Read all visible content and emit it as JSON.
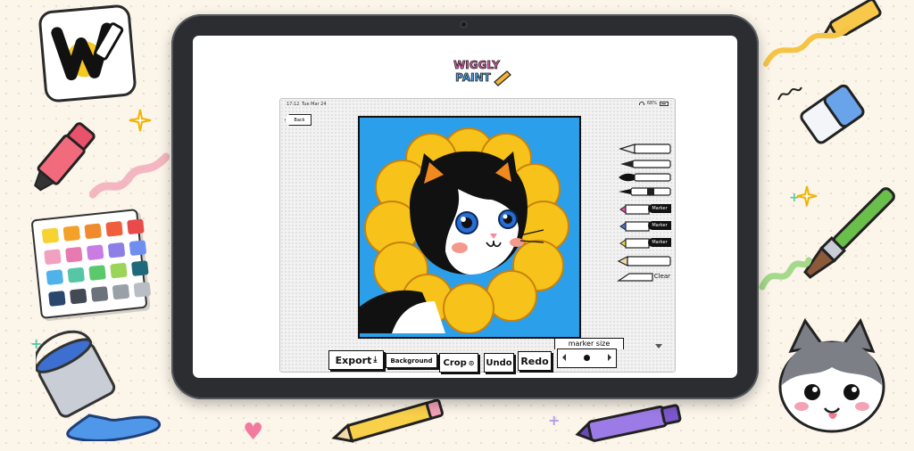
{
  "app": {
    "logo": {
      "line1": "WIGGLY",
      "line2": "PAINT"
    },
    "status": {
      "time": "17:12",
      "date": "Tue Mar 24",
      "battery": "68%"
    },
    "back_label": "Back",
    "toolbar": {
      "export": "Export",
      "background": "Background",
      "crop": "Crop",
      "undo": "Undo",
      "redo": "Redo"
    },
    "marker_size": {
      "label": "marker size"
    },
    "tools": [
      {
        "name": "fountain-pen",
        "label": ""
      },
      {
        "name": "felt-pen",
        "label": ""
      },
      {
        "name": "ink-brush",
        "label": ""
      },
      {
        "name": "fine-brush",
        "label": ""
      },
      {
        "name": "pink-marker",
        "label": "Marker",
        "color": "#e64ea8"
      },
      {
        "name": "blue-marker",
        "label": "Marker",
        "color": "#4a6fd8"
      },
      {
        "name": "yellow-marker",
        "label": "Marker",
        "color": "#f2d43c"
      },
      {
        "name": "pencil",
        "label": ""
      },
      {
        "name": "eraser",
        "label": "Clear"
      }
    ],
    "canvas_colors": {
      "sky": "#2b9fea",
      "petal": "#f7c21a",
      "petal_dark": "#e39b11",
      "fur": "#111111",
      "orange": "#f08a1e"
    }
  },
  "decor": {
    "palette_colors": [
      "#f6d232",
      "#f4a12a",
      "#f18a2c",
      "#ef5f3e",
      "#e94b4b",
      "#f2a0bf",
      "#e97ab0",
      "#c97de3",
      "#8d7fe6",
      "#6f8ef0",
      "#4fb2ea",
      "#56c6a6",
      "#5ac86b",
      "#9bd45a",
      "#1f6a7a",
      "#29486e",
      "#444a55",
      "#6c727c",
      "#9aa0a8",
      "#b9bec4"
    ],
    "logo_letter": "W"
  }
}
